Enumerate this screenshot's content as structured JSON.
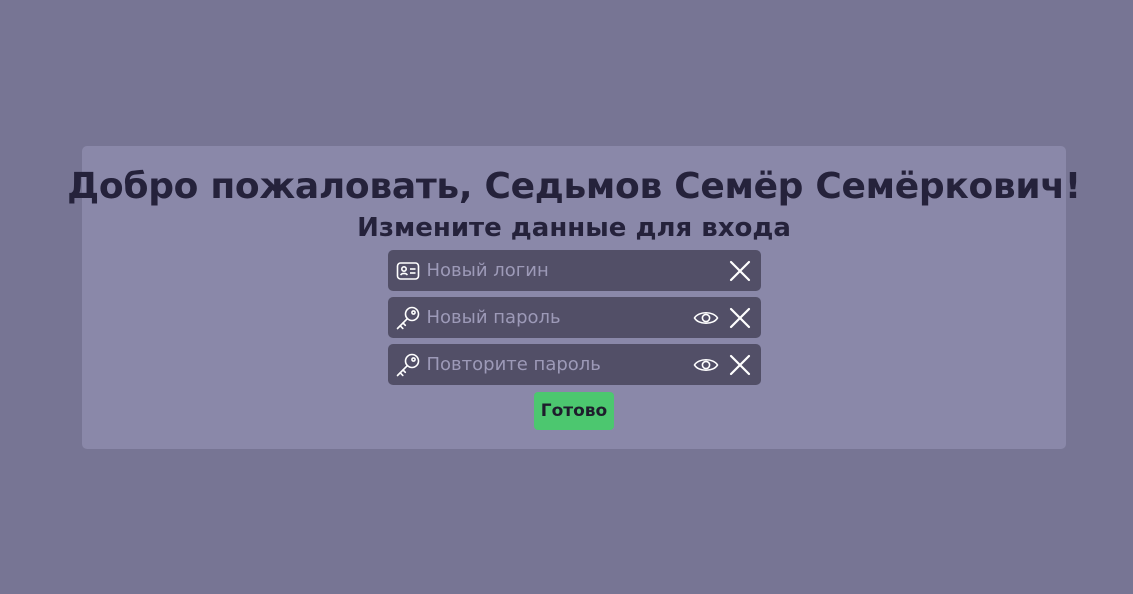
{
  "page": {
    "background_color": "#777594",
    "card_color": "#8a88a9",
    "field_color": "#524f67",
    "accent_color": "#4cc76f"
  },
  "header": {
    "title": "Добро пожаловать, Седьмов Семёр Семёркович!",
    "subtitle": "Измените данные для входа"
  },
  "form": {
    "login": {
      "placeholder": "Новый логин",
      "value": "",
      "icon": "id-card-icon",
      "actions": [
        "close-icon"
      ]
    },
    "password": {
      "placeholder": "Новый пароль",
      "value": "",
      "icon": "key-icon",
      "actions": [
        "eye-icon",
        "close-icon"
      ]
    },
    "password_repeat": {
      "placeholder": "Повторите пароль",
      "value": "",
      "icon": "key-icon",
      "actions": [
        "eye-icon",
        "close-icon"
      ]
    },
    "submit_label": "Готово"
  }
}
